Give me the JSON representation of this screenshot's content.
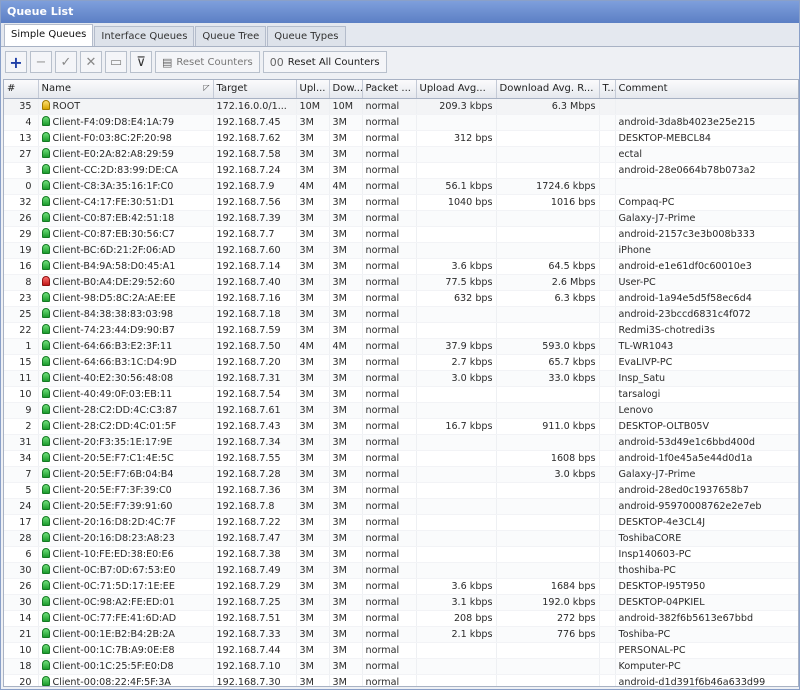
{
  "window": {
    "title": "Queue List"
  },
  "tabs": [
    "Simple Queues",
    "Interface Queues",
    "Queue Tree",
    "Queue Types"
  ],
  "toolbar": {
    "reset_counters": "Reset Counters",
    "reset_all_counters": "Reset All Counters",
    "reset_all_prefix": "00"
  },
  "colors": {
    "accent": "#1f3fa6",
    "titlebar": "#6a8bd0",
    "lamp_green": "#2bb03a",
    "lamp_red": "#d62020",
    "lamp_yellow": "#e0b000"
  },
  "columns": [
    "#",
    "Name",
    "Target",
    "Upl...",
    "Dow...",
    "Packet ...",
    "Upload Avg...",
    "Download Avg. R...",
    "T...",
    "Comment"
  ],
  "rows": [
    {
      "n": "35",
      "lamp": "yellow",
      "name": "ROOT",
      "target": "172.16.0.0/1...",
      "up": "10M",
      "down": "10M",
      "pkt": "normal",
      "upavg": "209.3 kbps",
      "downavg": "6.3 Mbps",
      "comment": ""
    },
    {
      "n": "4",
      "lamp": "green",
      "name": "Client-F4:09:D8:E4:1A:79",
      "target": "192.168.7.45",
      "up": "3M",
      "down": "3M",
      "pkt": "normal",
      "upavg": "",
      "downavg": "",
      "comment": "android-3da8b4023e25e215"
    },
    {
      "n": "13",
      "lamp": "green",
      "name": "Client-F0:03:8C:2F:20:98",
      "target": "192.168.7.62",
      "up": "3M",
      "down": "3M",
      "pkt": "normal",
      "upavg": "312 bps",
      "downavg": "",
      "comment": "DESKTOP-MEBCL84"
    },
    {
      "n": "27",
      "lamp": "green",
      "name": "Client-E0:2A:82:A8:29:59",
      "target": "192.168.7.58",
      "up": "3M",
      "down": "3M",
      "pkt": "normal",
      "upavg": "",
      "downavg": "",
      "comment": "ectal"
    },
    {
      "n": "3",
      "lamp": "green",
      "name": "Client-CC:2D:83:99:DE:CA",
      "target": "192.168.7.24",
      "up": "3M",
      "down": "3M",
      "pkt": "normal",
      "upavg": "",
      "downavg": "",
      "comment": "android-28e0664b78b073a2"
    },
    {
      "n": "0",
      "lamp": "green",
      "name": "Client-C8:3A:35:16:1F:C0",
      "target": "192.168.7.9",
      "up": "4M",
      "down": "4M",
      "pkt": "normal",
      "upavg": "56.1 kbps",
      "downavg": "1724.6 kbps",
      "comment": ""
    },
    {
      "n": "32",
      "lamp": "green",
      "name": "Client-C4:17:FE:30:51:D1",
      "target": "192.168.7.56",
      "up": "3M",
      "down": "3M",
      "pkt": "normal",
      "upavg": "1040 bps",
      "downavg": "1016 bps",
      "comment": "Compaq-PC"
    },
    {
      "n": "26",
      "lamp": "green",
      "name": "Client-C0:87:EB:42:51:18",
      "target": "192.168.7.39",
      "up": "3M",
      "down": "3M",
      "pkt": "normal",
      "upavg": "",
      "downavg": "",
      "comment": "Galaxy-J7-Prime"
    },
    {
      "n": "29",
      "lamp": "green",
      "name": "Client-C0:87:EB:30:56:C7",
      "target": "192.168.7.7",
      "up": "3M",
      "down": "3M",
      "pkt": "normal",
      "upavg": "",
      "downavg": "",
      "comment": "android-2157c3e3b008b333"
    },
    {
      "n": "19",
      "lamp": "green",
      "name": "Client-BC:6D:21:2F:06:AD",
      "target": "192.168.7.60",
      "up": "3M",
      "down": "3M",
      "pkt": "normal",
      "upavg": "",
      "downavg": "",
      "comment": "iPhone"
    },
    {
      "n": "16",
      "lamp": "green",
      "name": "Client-B4:9A:58:D0:45:A1",
      "target": "192.168.7.14",
      "up": "3M",
      "down": "3M",
      "pkt": "normal",
      "upavg": "3.6 kbps",
      "downavg": "64.5 kbps",
      "comment": "android-e1e61df0c60010e3"
    },
    {
      "n": "8",
      "lamp": "red",
      "name": "Client-B0:A4:DE:29:52:60",
      "target": "192.168.7.40",
      "up": "3M",
      "down": "3M",
      "pkt": "normal",
      "upavg": "77.5 kbps",
      "downavg": "2.6 Mbps",
      "comment": "User-PC"
    },
    {
      "n": "23",
      "lamp": "green",
      "name": "Client-98:D5:8C:2A:AE:EE",
      "target": "192.168.7.16",
      "up": "3M",
      "down": "3M",
      "pkt": "normal",
      "upavg": "632 bps",
      "downavg": "6.3 kbps",
      "comment": "android-1a94e5d5f58ec6d4"
    },
    {
      "n": "25",
      "lamp": "green",
      "name": "Client-84:38:38:83:03:98",
      "target": "192.168.7.18",
      "up": "3M",
      "down": "3M",
      "pkt": "normal",
      "upavg": "",
      "downavg": "",
      "comment": "android-23bccd6831c4f072"
    },
    {
      "n": "22",
      "lamp": "green",
      "name": "Client-74:23:44:D9:90:B7",
      "target": "192.168.7.59",
      "up": "3M",
      "down": "3M",
      "pkt": "normal",
      "upavg": "",
      "downavg": "",
      "comment": "Redmi3S-chotredi3s"
    },
    {
      "n": "1",
      "lamp": "green",
      "name": "Client-64:66:B3:E2:3F:11",
      "target": "192.168.7.50",
      "up": "4M",
      "down": "4M",
      "pkt": "normal",
      "upavg": "37.9 kbps",
      "downavg": "593.0 kbps",
      "comment": "TL-WR1043"
    },
    {
      "n": "15",
      "lamp": "green",
      "name": "Client-64:66:B3:1C:D4:9D",
      "target": "192.168.7.20",
      "up": "3M",
      "down": "3M",
      "pkt": "normal",
      "upavg": "2.7 kbps",
      "downavg": "65.7 kbps",
      "comment": "EvaLIVP-PC"
    },
    {
      "n": "11",
      "lamp": "green",
      "name": "Client-40:E2:30:56:48:08",
      "target": "192.168.7.31",
      "up": "3M",
      "down": "3M",
      "pkt": "normal",
      "upavg": "3.0 kbps",
      "downavg": "33.0 kbps",
      "comment": "Insp_Satu"
    },
    {
      "n": "10",
      "lamp": "green",
      "name": "Client-40:49:0F:03:EB:11",
      "target": "192.168.7.54",
      "up": "3M",
      "down": "3M",
      "pkt": "normal",
      "upavg": "",
      "downavg": "",
      "comment": "tarsalogi"
    },
    {
      "n": "9",
      "lamp": "green",
      "name": "Client-28:C2:DD:4C:C3:87",
      "target": "192.168.7.61",
      "up": "3M",
      "down": "3M",
      "pkt": "normal",
      "upavg": "",
      "downavg": "",
      "comment": "Lenovo"
    },
    {
      "n": "2",
      "lamp": "green",
      "name": "Client-28:C2:DD:4C:01:5F",
      "target": "192.168.7.43",
      "up": "3M",
      "down": "3M",
      "pkt": "normal",
      "upavg": "16.7 kbps",
      "downavg": "911.0 kbps",
      "comment": "DESKTOP-OLTB05V"
    },
    {
      "n": "31",
      "lamp": "green",
      "name": "Client-20:F3:35:1E:17:9E",
      "target": "192.168.7.34",
      "up": "3M",
      "down": "3M",
      "pkt": "normal",
      "upavg": "",
      "downavg": "",
      "comment": "android-53d49e1c6bbd400d"
    },
    {
      "n": "34",
      "lamp": "green",
      "name": "Client-20:5E:F7:C1:4E:5C",
      "target": "192.168.7.55",
      "up": "3M",
      "down": "3M",
      "pkt": "normal",
      "upavg": "",
      "downavg": "1608 bps",
      "comment": "android-1f0e45a5e44d0d1a"
    },
    {
      "n": "7",
      "lamp": "green",
      "name": "Client-20:5E:F7:6B:04:B4",
      "target": "192.168.7.28",
      "up": "3M",
      "down": "3M",
      "pkt": "normal",
      "upavg": "",
      "downavg": "3.0 kbps",
      "comment": "Galaxy-J7-Prime"
    },
    {
      "n": "5",
      "lamp": "green",
      "name": "Client-20:5E:F7:3F:39:C0",
      "target": "192.168.7.36",
      "up": "3M",
      "down": "3M",
      "pkt": "normal",
      "upavg": "",
      "downavg": "",
      "comment": "android-28ed0c1937658b7"
    },
    {
      "n": "24",
      "lamp": "green",
      "name": "Client-20:5E:F7:39:91:60",
      "target": "192.168.7.8",
      "up": "3M",
      "down": "3M",
      "pkt": "normal",
      "upavg": "",
      "downavg": "",
      "comment": "android-95970008762e2e7eb"
    },
    {
      "n": "17",
      "lamp": "green",
      "name": "Client-20:16:D8:2D:4C:7F",
      "target": "192.168.7.22",
      "up": "3M",
      "down": "3M",
      "pkt": "normal",
      "upavg": "",
      "downavg": "",
      "comment": "DESKTOP-4e3CL4J"
    },
    {
      "n": "28",
      "lamp": "green",
      "name": "Client-20:16:D8:23:A8:23",
      "target": "192.168.7.47",
      "up": "3M",
      "down": "3M",
      "pkt": "normal",
      "upavg": "",
      "downavg": "",
      "comment": "ToshibaCORE"
    },
    {
      "n": "6",
      "lamp": "green",
      "name": "Client-10:FE:ED:38:E0:E6",
      "target": "192.168.7.38",
      "up": "3M",
      "down": "3M",
      "pkt": "normal",
      "upavg": "",
      "downavg": "",
      "comment": "Insp140603-PC"
    },
    {
      "n": "30",
      "lamp": "green",
      "name": "Client-0C:B7:0D:67:53:E0",
      "target": "192.168.7.49",
      "up": "3M",
      "down": "3M",
      "pkt": "normal",
      "upavg": "",
      "downavg": "",
      "comment": "thoshiba-PC"
    },
    {
      "n": "26",
      "lamp": "green",
      "name": "Client-0C:71:5D:17:1E:EE",
      "target": "192.168.7.29",
      "up": "3M",
      "down": "3M",
      "pkt": "normal",
      "upavg": "3.6 kbps",
      "downavg": "1684 bps",
      "comment": "DESKTOP-I95T950"
    },
    {
      "n": "30",
      "lamp": "green",
      "name": "Client-0C:98:A2:FE:ED:01",
      "target": "192.168.7.25",
      "up": "3M",
      "down": "3M",
      "pkt": "normal",
      "upavg": "3.1 kbps",
      "downavg": "192.0 kbps",
      "comment": "DESKTOP-04PKIEL"
    },
    {
      "n": "14",
      "lamp": "green",
      "name": "Client-0C:77:FE:41:6D:AD",
      "target": "192.168.7.51",
      "up": "3M",
      "down": "3M",
      "pkt": "normal",
      "upavg": "208 bps",
      "downavg": "272 bps",
      "comment": "android-382f6b5613e67bbd"
    },
    {
      "n": "21",
      "lamp": "green",
      "name": "Client-00:1E:B2:B4:2B:2A",
      "target": "192.168.7.33",
      "up": "3M",
      "down": "3M",
      "pkt": "normal",
      "upavg": "2.1 kbps",
      "downavg": "776 bps",
      "comment": "Toshiba-PC"
    },
    {
      "n": "10",
      "lamp": "green",
      "name": "Client-00:1C:7B:A9:0E:E8",
      "target": "192.168.7.44",
      "up": "3M",
      "down": "3M",
      "pkt": "normal",
      "upavg": "",
      "downavg": "",
      "comment": "PERSONAL-PC"
    },
    {
      "n": "18",
      "lamp": "green",
      "name": "Client-00:1C:25:5F:E0:D8",
      "target": "192.168.7.10",
      "up": "3M",
      "down": "3M",
      "pkt": "normal",
      "upavg": "",
      "downavg": "",
      "comment": "Komputer-PC"
    },
    {
      "n": "20",
      "lamp": "green",
      "name": "Client-00:08:22:4F:5F:3A",
      "target": "192.168.7.30",
      "up": "3M",
      "down": "3M",
      "pkt": "normal",
      "upavg": "",
      "downavg": "",
      "comment": "android-d1d391f6b46a633d99"
    }
  ]
}
